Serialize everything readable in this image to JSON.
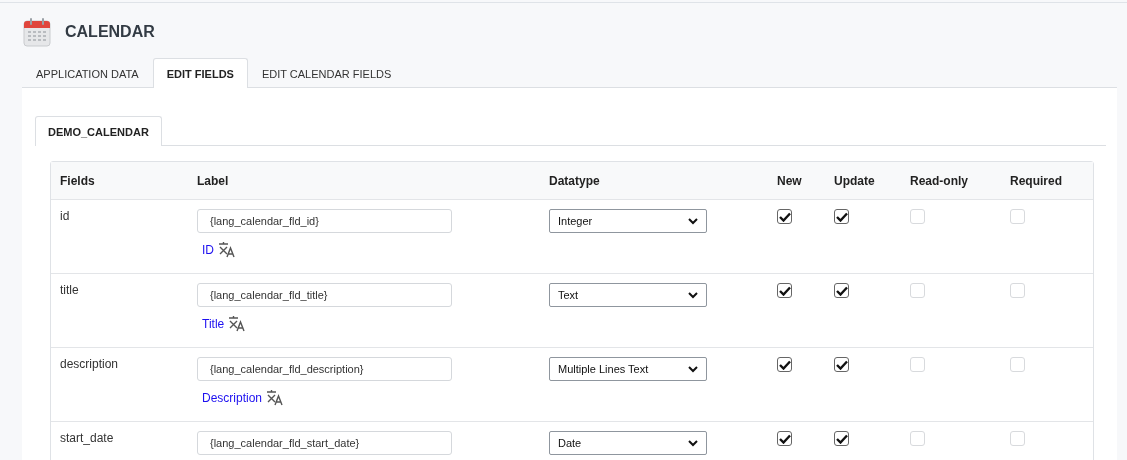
{
  "page": {
    "title": "CALENDAR"
  },
  "tabs": [
    {
      "label": "APPLICATION DATA",
      "selected": false
    },
    {
      "label": "EDIT FIELDS",
      "selected": true
    },
    {
      "label": "EDIT CALENDAR FIELDS",
      "selected": false
    }
  ],
  "subtabs": [
    {
      "label": "DEMO_CALENDAR",
      "selected": true
    }
  ],
  "table": {
    "columns": [
      "Fields",
      "Label",
      "Datatype",
      "New",
      "Update",
      "Read-only",
      "Required"
    ],
    "rows": [
      {
        "field": "id",
        "label_value": "{lang_calendar_fld_id}",
        "translation": "ID",
        "datatype": "Integer",
        "flags": [
          {
            "checked": true
          },
          {
            "checked": true
          },
          {
            "checked": false
          },
          {
            "checked": false
          }
        ]
      },
      {
        "field": "title",
        "label_value": "{lang_calendar_fld_title}",
        "translation": "Title",
        "datatype": "Text",
        "flags": [
          {
            "checked": true
          },
          {
            "checked": true
          },
          {
            "checked": false
          },
          {
            "checked": false
          }
        ]
      },
      {
        "field": "description",
        "label_value": "{lang_calendar_fld_description}",
        "translation": "Description",
        "datatype": "Multiple Lines Text",
        "flags": [
          {
            "checked": true
          },
          {
            "checked": true
          },
          {
            "checked": false
          },
          {
            "checked": false
          }
        ]
      },
      {
        "field": "start_date",
        "label_value": "{lang_calendar_fld_start_date}",
        "datatype": "Date",
        "flags": [
          {
            "checked": true
          },
          {
            "checked": true
          },
          {
            "checked": false
          },
          {
            "checked": false
          }
        ]
      }
    ]
  }
}
